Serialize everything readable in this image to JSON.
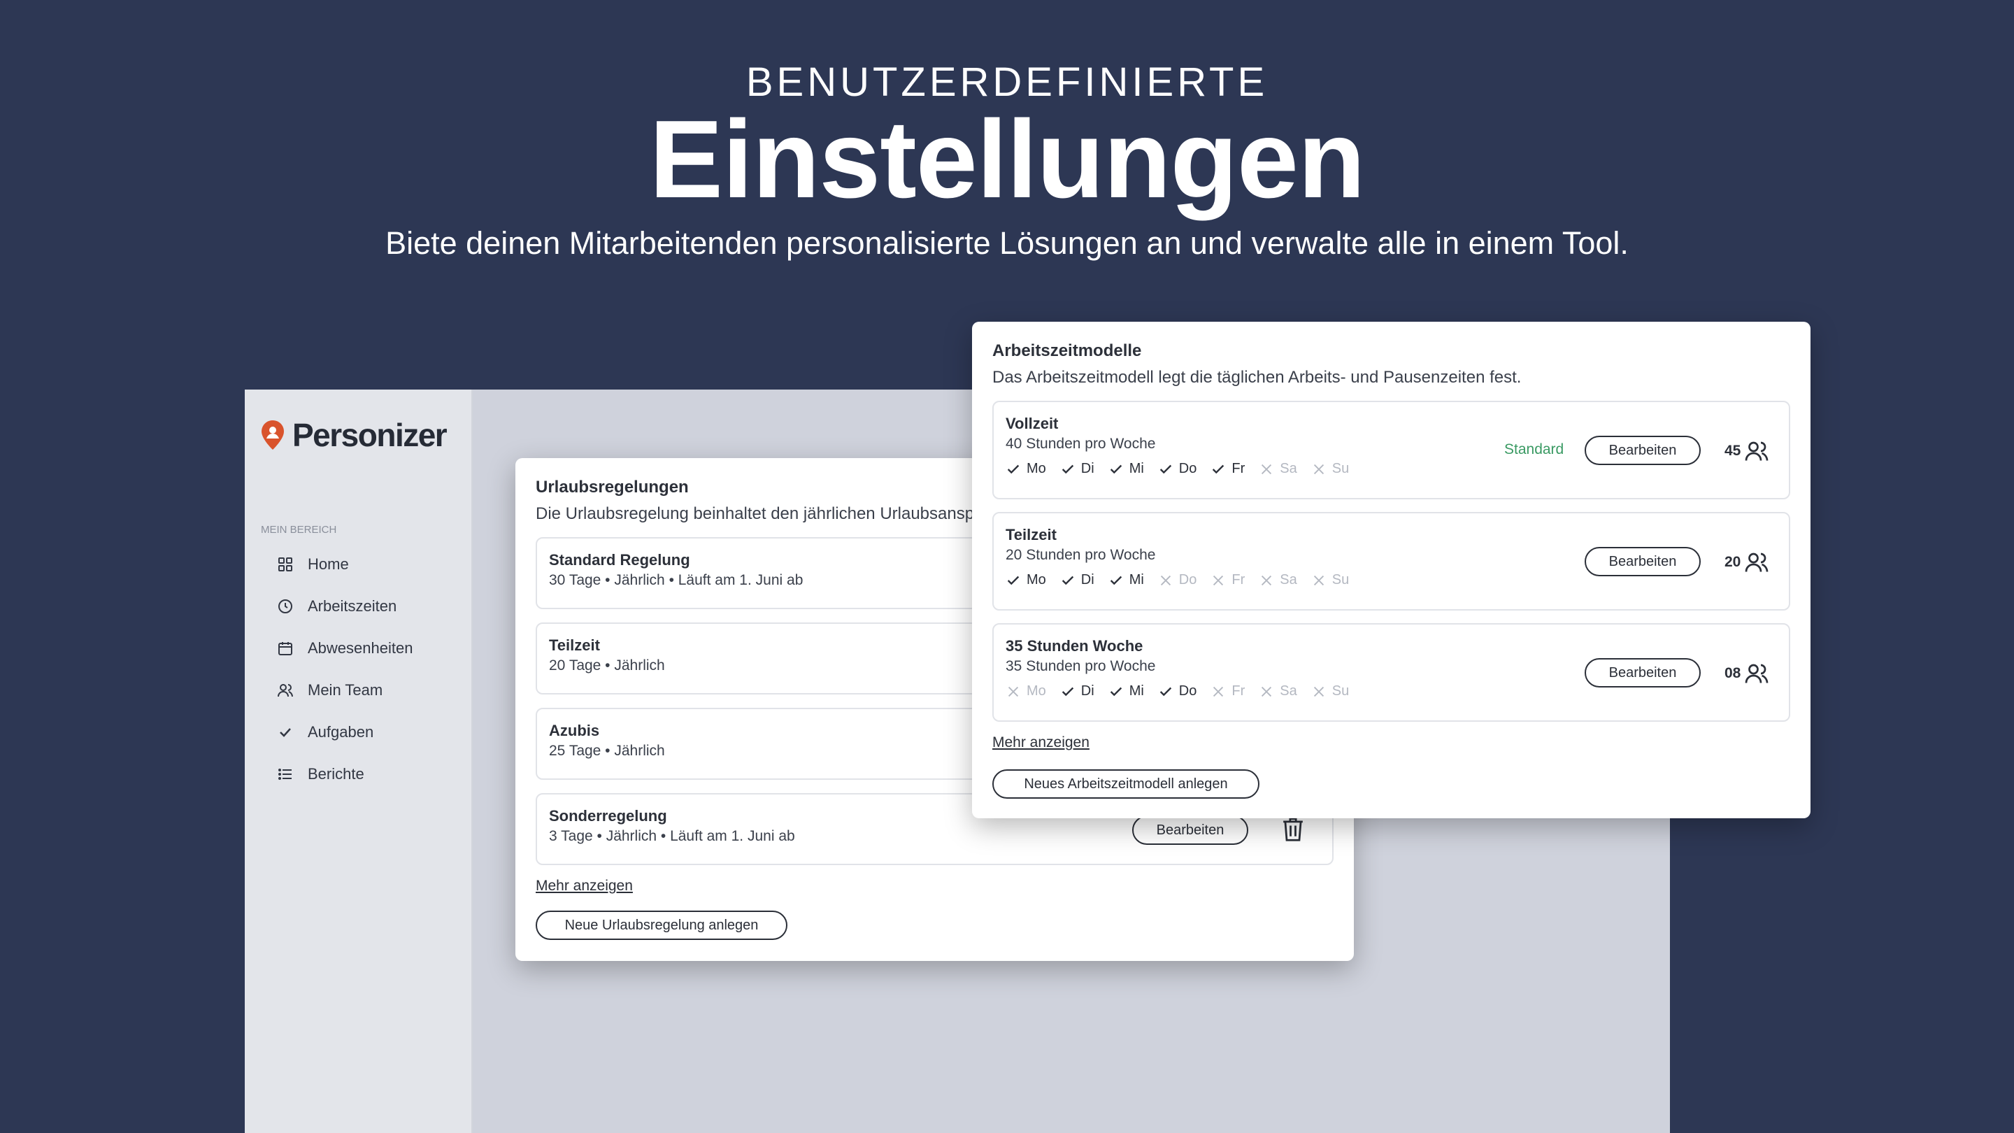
{
  "hero": {
    "sup": "BENUTZERDEFINIERTE",
    "title": "Einstellungen",
    "subtitle": "Biete deinen Mitarbeitenden personalisierte Lösungen an und verwalte alle in einem Tool."
  },
  "app": {
    "logo": "Personizer",
    "section_label": "MEIN BEREICH",
    "nav": [
      {
        "label": "Home",
        "icon": "grid-icon"
      },
      {
        "label": "Arbeitszeiten",
        "icon": "clock-icon"
      },
      {
        "label": "Abwesenheiten",
        "icon": "calendar-icon"
      },
      {
        "label": "Mein Team",
        "icon": "users-icon"
      },
      {
        "label": "Aufgaben",
        "icon": "check-icon"
      },
      {
        "label": "Berichte",
        "icon": "list-icon"
      }
    ]
  },
  "vacation": {
    "title": "Urlaubsregelungen",
    "description": "Die Urlaubsregelung beinhaltet den jährlichen Urlaubsanspruch.",
    "rows": [
      {
        "name": "Standard Regelung",
        "meta": "30 Tage • Jährlich • Läuft am 1. Juni ab"
      },
      {
        "name": "Teilzeit",
        "meta": "20 Tage • Jährlich"
      },
      {
        "name": "Azubis",
        "meta": "25 Tage • Jährlich"
      },
      {
        "name": "Sonderregelung",
        "meta": "3 Tage • Jährlich • Läuft am 1. Juni ab",
        "edit_label": "Bearbeiten"
      }
    ],
    "more": "Mehr anzeigen",
    "new_button": "Neue Urlaubsregelung anlegen"
  },
  "models": {
    "title": "Arbeitszeitmodelle",
    "description": "Das Arbeitszeitmodell legt die täglichen Arbeits- und Pausenzeiten fest.",
    "edit_label": "Bearbeiten",
    "standard_label": "Standard",
    "rows": [
      {
        "name": "Vollzeit",
        "meta": "40 Stunden pro Woche",
        "count": "45",
        "standard": true,
        "days": [
          {
            "d": "Mo",
            "on": true
          },
          {
            "d": "Di",
            "on": true
          },
          {
            "d": "Mi",
            "on": true
          },
          {
            "d": "Do",
            "on": true
          },
          {
            "d": "Fr",
            "on": true
          },
          {
            "d": "Sa",
            "on": false
          },
          {
            "d": "Su",
            "on": false
          }
        ]
      },
      {
        "name": "Teilzeit",
        "meta": "20 Stunden pro Woche",
        "count": "20",
        "standard": false,
        "days": [
          {
            "d": "Mo",
            "on": true
          },
          {
            "d": "Di",
            "on": true
          },
          {
            "d": "Mi",
            "on": true
          },
          {
            "d": "Do",
            "on": false
          },
          {
            "d": "Fr",
            "on": false
          },
          {
            "d": "Sa",
            "on": false
          },
          {
            "d": "Su",
            "on": false
          }
        ]
      },
      {
        "name": "35 Stunden Woche",
        "meta": "35 Stunden pro Woche",
        "count": "08",
        "standard": false,
        "days": [
          {
            "d": "Mo",
            "on": false
          },
          {
            "d": "Di",
            "on": true
          },
          {
            "d": "Mi",
            "on": true
          },
          {
            "d": "Do",
            "on": true
          },
          {
            "d": "Fr",
            "on": false
          },
          {
            "d": "Sa",
            "on": false
          },
          {
            "d": "Su",
            "on": false
          }
        ]
      }
    ],
    "more": "Mehr anzeigen",
    "new_button": "Neues Arbeitszeitmodell anlegen"
  },
  "colors": {
    "background": "#2d3754",
    "accent_logo": "#d9532c",
    "standard_green": "#3a9a63"
  }
}
